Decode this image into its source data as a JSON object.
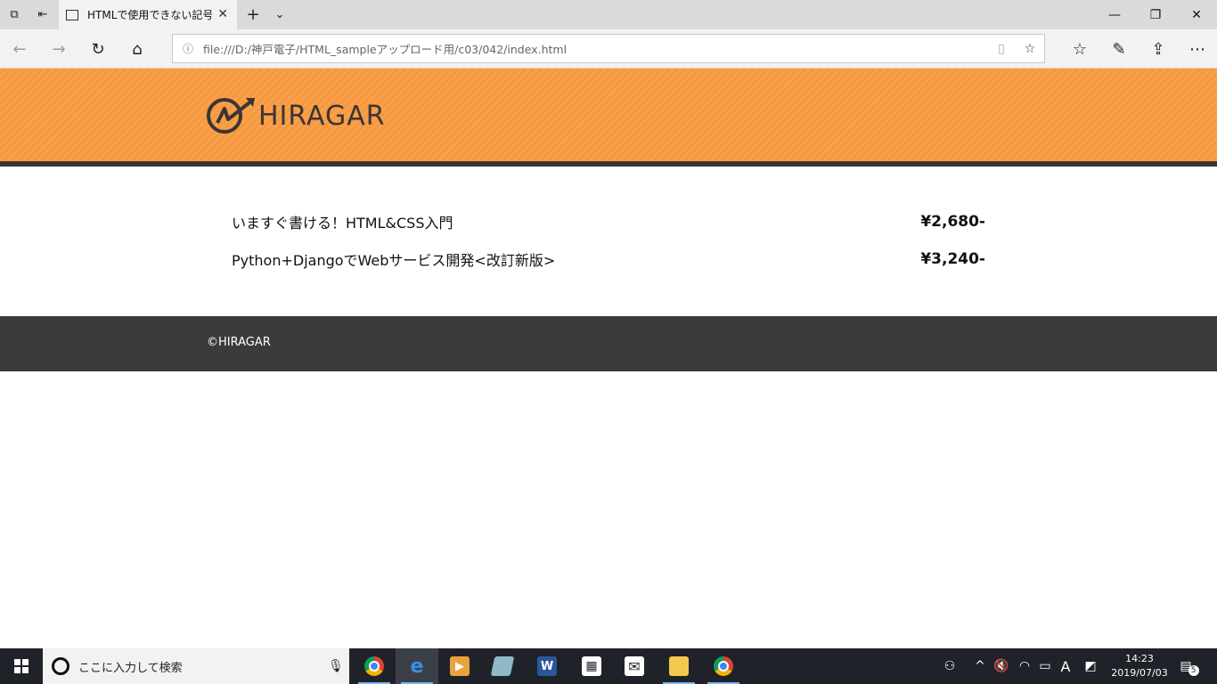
{
  "browser": {
    "tab": {
      "title": "HTMLで使用できない記号"
    },
    "address": {
      "url": "file:///D:/神戸電子/HTML_sampleアップロード用/c03/042/index.html"
    }
  },
  "page": {
    "logo_text": "HIRAGAR",
    "items": [
      {
        "name": "いますぐ書ける！HTML&CSS入門",
        "price": "¥2,680-"
      },
      {
        "name": "Python+DjangoでWebサービス開発<改訂新版>",
        "price": "¥3,240-"
      }
    ],
    "footer": {
      "copyright": "©HIRAGAR"
    }
  },
  "taskbar": {
    "search_placeholder": "ここに入力して検索",
    "clock": {
      "time": "14:23",
      "date": "2019/07/03"
    },
    "notification_count": "5",
    "ime_indicator": "A"
  },
  "colors": {
    "header_orange": "#f7993f",
    "header_dark": "#3b3535",
    "footer_dark": "#3b3b3b",
    "taskbar": "#1f2229"
  }
}
